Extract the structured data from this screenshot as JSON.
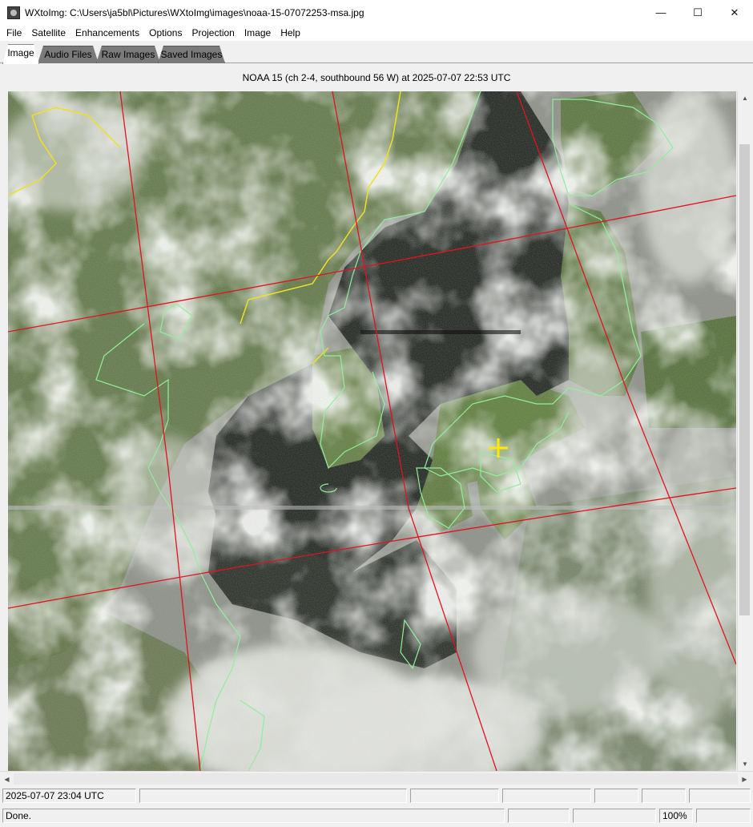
{
  "window": {
    "title": "WXtoImg: C:\\Users\\ja5bl\\Pictures\\WXtoImg\\images\\noaa-15-07072253-msa.jpg",
    "minimize": "—",
    "maximize": "☐",
    "close": "✕"
  },
  "menu": [
    "File",
    "Satellite",
    "Enhancements",
    "Options",
    "Projection",
    "Image",
    "Help"
  ],
  "tabs": [
    "Image",
    "Audio Files",
    "Raw Images",
    "Saved Images"
  ],
  "active_tab": "Image",
  "caption": "NOAA 15 (ch 2-4, southbound 56 W) at 2025-07-07  22:53 UTC",
  "colors": {
    "grid_lines": "#e0141e",
    "coastlines": "#8ef09a",
    "borders": "#f0e020",
    "marker": "#ffea00"
  },
  "status": {
    "datetime": "2025-07-07  23:04 UTC",
    "message": "Done.",
    "zoom": "100%"
  }
}
